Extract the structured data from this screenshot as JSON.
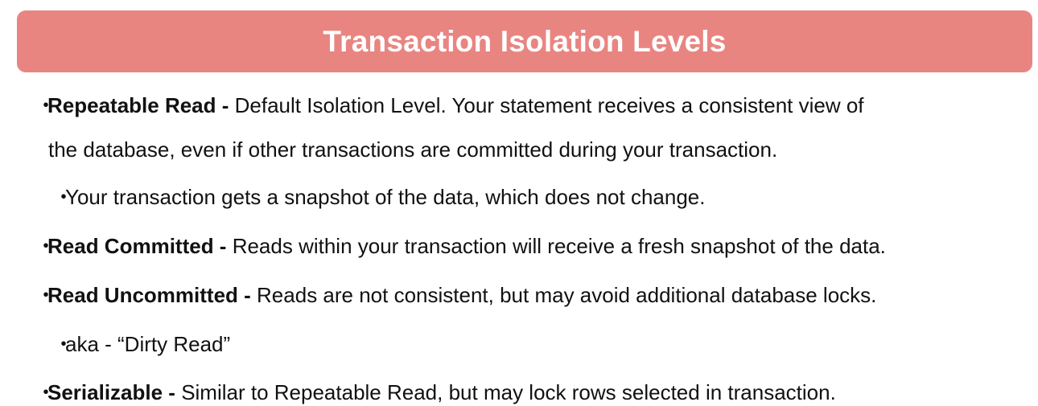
{
  "title": "Transaction Isolation Levels",
  "bullet_glyph": "・",
  "items": [
    {
      "term": "Repeatable Read",
      "separator": " - ",
      "desc_line1": "Default Isolation Level. Your statement receives a consistent view of",
      "desc_line2": "the database, even if other transactions are committed during your transaction.",
      "sub": "Your transaction gets a snapshot of the data, which does not change."
    },
    {
      "term": "Read Committed",
      "separator": " - ",
      "desc": "Reads within your transaction will receive a fresh snapshot of the data."
    },
    {
      "term": "Read Uncommitted",
      "separator": " - ",
      "desc": "Reads are not consistent, but may avoid additional database locks.",
      "sub": "aka - “Dirty Read”"
    },
    {
      "term": "Serializable",
      "separator": " - ",
      "desc": "Similar to Repeatable Read, but may lock rows selected in transaction."
    }
  ],
  "colors": {
    "title_bg": "#e98581",
    "title_text": "#ffffff",
    "body_text": "#111111"
  }
}
